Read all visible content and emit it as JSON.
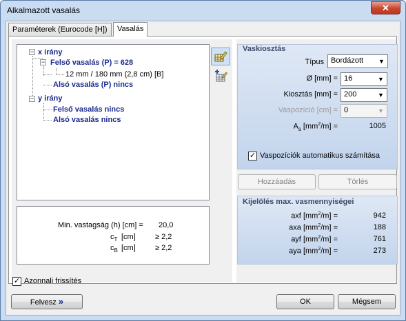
{
  "window": {
    "title": "Alkalmazott vasalás",
    "close_label": "✕"
  },
  "tabs": [
    {
      "label": "Paraméterek (Eurocode [H])"
    },
    {
      "label": "Vasalás"
    }
  ],
  "tree": {
    "x_node": "x irány",
    "x_top": "Felső vasalás (P) = 628",
    "x_top_detail": "12 mm / 180 mm (2,8 cm) [B]",
    "x_bottom": "Alsó vasalás (P) nincs",
    "y_node": "y irány",
    "y_top": "Felső vasalás nincs",
    "y_bottom": "Alsó vasalás nincs"
  },
  "info": {
    "min_thickness_label": "Min. vastagság (h) [cm] =",
    "min_thickness_value": "20,0",
    "ct_label": "c",
    "ct_sub": "T",
    "ct_unit": "[cm]",
    "ct_value": "≥ 2,2",
    "cb_label": "c",
    "cb_sub": "B",
    "cb_unit": "[cm]",
    "cb_value": "≥ 2,2"
  },
  "rebar": {
    "header": "Vaskiosztás",
    "type_label": "Típus",
    "type_value": "Bordázott",
    "dia_label": "Ø [mm] =",
    "dia_value": "16",
    "spacing_label": "Kiosztás [mm] =",
    "spacing_value": "200",
    "position_label": "Vaspozíció [cm] =",
    "position_value": "0",
    "as_label": "A",
    "as_sub": "s",
    "as_unit": " [mm",
    "as_sup": "2",
    "as_unit2": "/m] =",
    "as_value": "1005",
    "auto_label": "Vaspozíciók automatikus számítása"
  },
  "buttons": {
    "add": "Hozzáadás",
    "delete": "Törlés",
    "ok": "OK",
    "cancel": "Mégsem",
    "back": "Felvesz",
    "back_arrows": "»"
  },
  "selection": {
    "header": "Kijelölés max. vasmennyiségei",
    "rows": [
      {
        "label": "axf",
        "value": "942"
      },
      {
        "label": "axa",
        "value": "188"
      },
      {
        "label": "ayf",
        "value": "761"
      },
      {
        "label": "aya",
        "value": "273"
      }
    ],
    "unit_pre": "[mm",
    "unit_sup": "2",
    "unit_post": "/m] ="
  },
  "live_update": "Azonnali frissítés"
}
